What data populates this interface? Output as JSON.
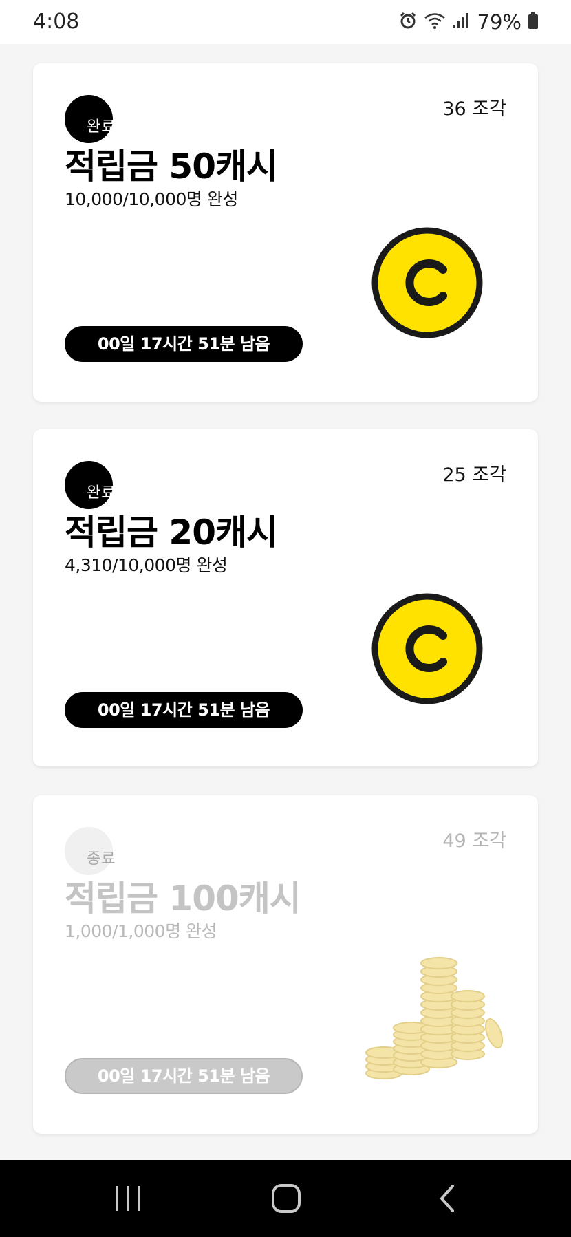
{
  "status_bar": {
    "time": "4:08",
    "battery": "79%",
    "icons": [
      "alarm-icon",
      "wifi-icon",
      "signal-icon",
      "battery-icon"
    ]
  },
  "cards": [
    {
      "pieces": "36 조각",
      "badge": "완료",
      "title": "적립금 50캐시",
      "progress": "10,000/10,000명 완성",
      "timer": "00일 17시간 51분 남음",
      "image": "coin-icon",
      "state": "active"
    },
    {
      "pieces": "25 조각",
      "badge": "완료",
      "title": "적립금 20캐시",
      "progress": "4,310/10,000명 완성",
      "timer": "00일 17시간 51분 남음",
      "image": "coin-icon",
      "state": "active"
    },
    {
      "pieces": "49 조각",
      "badge": "종료",
      "title": "적립금 100캐시",
      "progress": "1,000/1,000명 완성",
      "timer": "00일 17시간 51분 남음",
      "image": "coin-stack-icon",
      "state": "ended"
    }
  ],
  "colors": {
    "coin_yellow": "#FFE200",
    "coin_outline": "#1a1a1a",
    "background": "#f5f5f5"
  },
  "nav_bar": {
    "buttons": [
      "recent-apps-icon",
      "home-icon",
      "back-icon"
    ]
  }
}
